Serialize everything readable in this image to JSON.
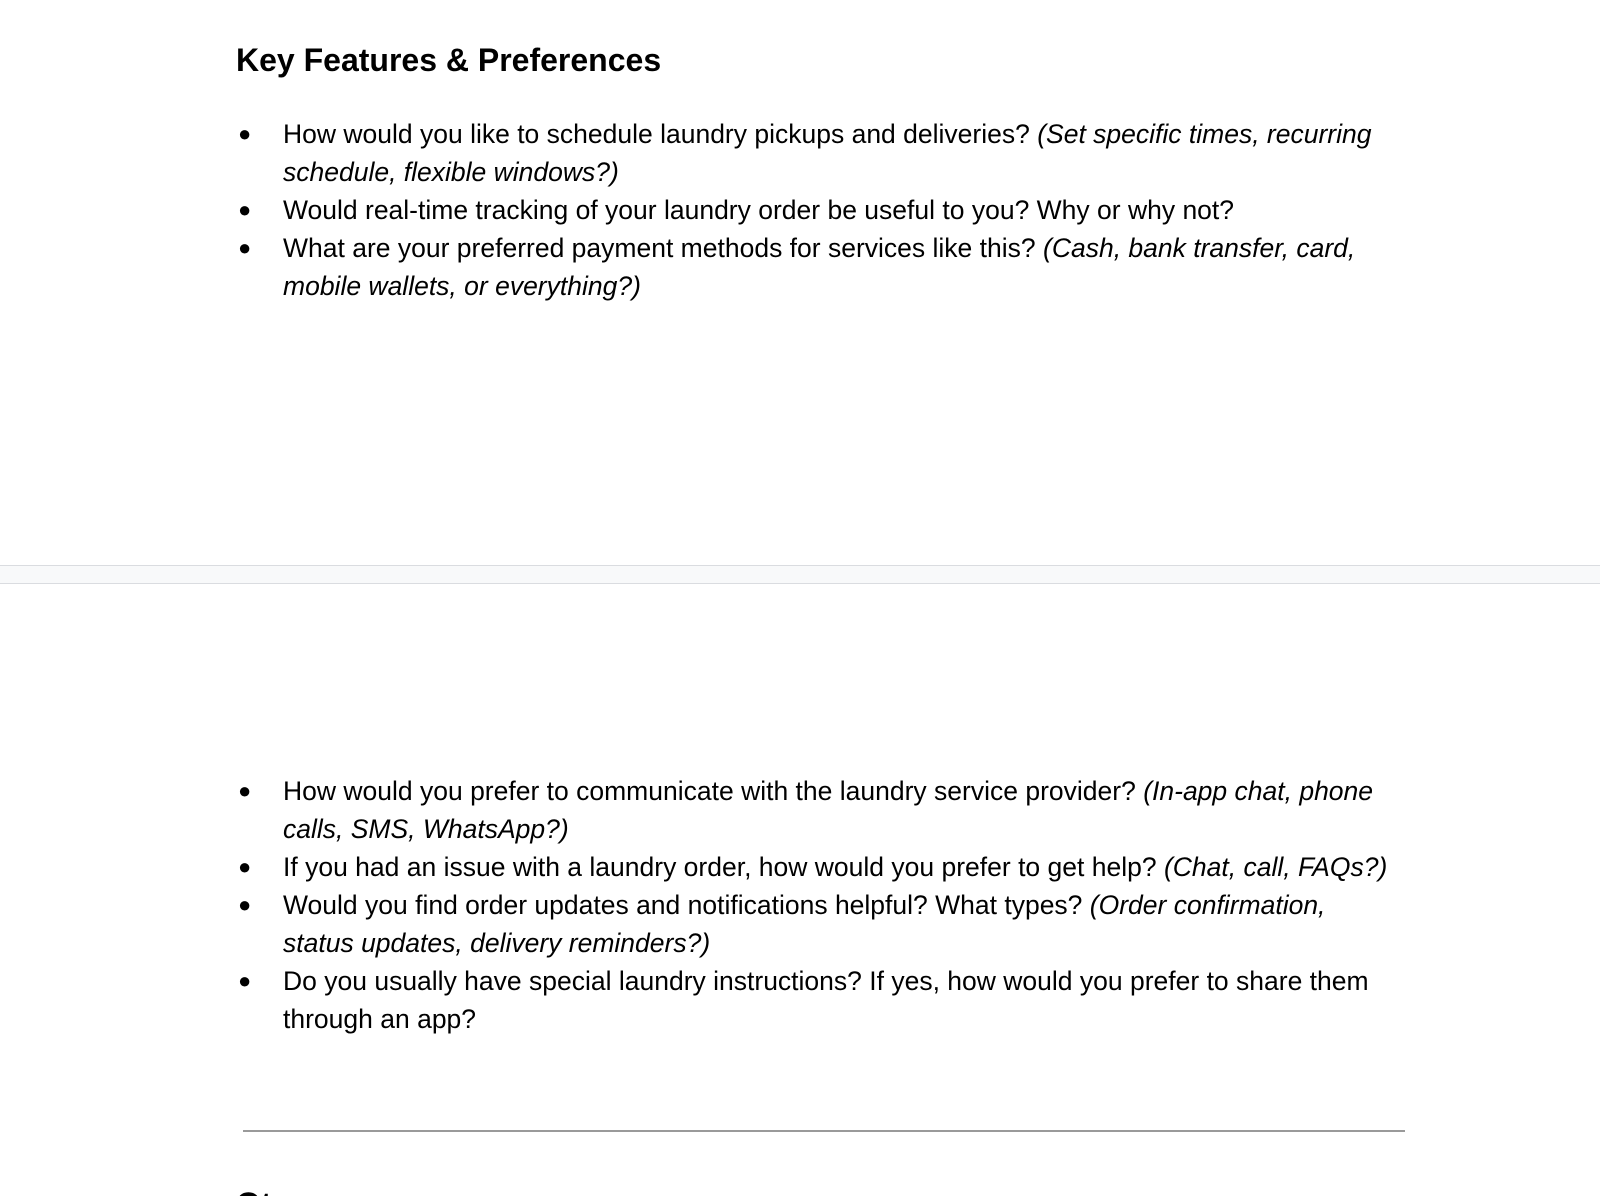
{
  "heading": "Key Features & Preferences",
  "questions_page1": [
    {
      "text": "How would you like to schedule laundry pickups and deliveries? ",
      "hint": "(Set specific times, recurring schedule, flexible windows?)"
    },
    {
      "text": "Would real-time tracking of your laundry order be useful to you? Why or why not?",
      "hint": ""
    },
    {
      "text": "What are your preferred payment methods for services like this? ",
      "hint": "(Cash, bank transfer, card, mobile wallets, or everything?)"
    }
  ],
  "questions_page2": [
    {
      "text": "How would you prefer to communicate with the laundry service provider? ",
      "hint": "(In-app chat, phone calls, SMS, WhatsApp?)"
    },
    {
      "text": "If you had an issue with a laundry order, how would you prefer to get help? ",
      "hint": "(Chat, call, FAQs?)"
    },
    {
      "text": "Would you find order updates and notifications helpful? What types? ",
      "hint": "(Order confirmation, status updates, delivery reminders?)"
    },
    {
      "text": "Do you usually have special laundry instructions? If yes, how would you prefer to share them through an app?",
      "hint": ""
    }
  ],
  "bullet_char": "●",
  "next_heading": "Ot"
}
